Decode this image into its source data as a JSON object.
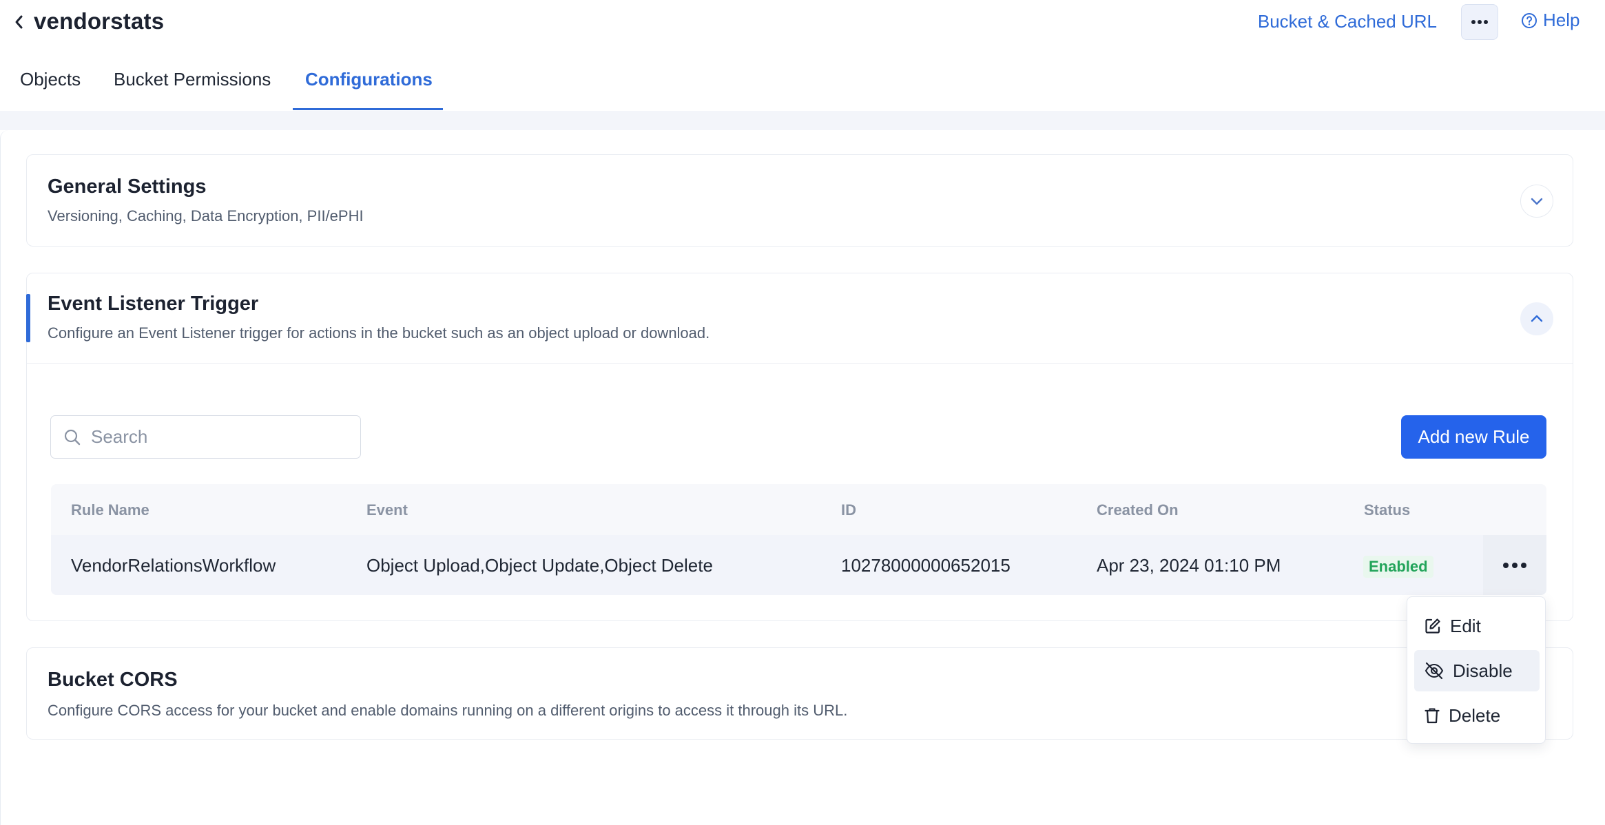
{
  "header": {
    "title": "vendorstats",
    "bucket_url_label": "Bucket & Cached URL",
    "help_label": "Help"
  },
  "tabs": [
    {
      "label": "Objects",
      "active": false
    },
    {
      "label": "Bucket Permissions",
      "active": false
    },
    {
      "label": "Configurations",
      "active": true
    }
  ],
  "panels": {
    "general": {
      "title": "General Settings",
      "description": "Versioning, Caching, Data Encryption, PII/ePHI",
      "expanded": false
    },
    "event_listener": {
      "title": "Event Listener Trigger",
      "description": "Configure an Event Listener trigger for actions in the bucket such as an object upload or download.",
      "expanded": true,
      "search_placeholder": "Search",
      "add_rule_label": "Add new Rule",
      "table": {
        "columns": [
          "Rule Name",
          "Event",
          "ID",
          "Created On",
          "Status"
        ],
        "rows": [
          {
            "rule_name": "VendorRelationsWorkflow",
            "event": "Object Upload,Object Update,Object Delete",
            "id": "10278000000652015",
            "created_on": "Apr 23, 2024 01:10 PM",
            "status": "Enabled"
          }
        ]
      },
      "row_menu": {
        "items": [
          {
            "label": "Edit",
            "icon": "edit-icon"
          },
          {
            "label": "Disable",
            "icon": "eye-off-icon"
          },
          {
            "label": "Delete",
            "icon": "trash-icon"
          }
        ]
      }
    },
    "cors": {
      "title": "Bucket CORS",
      "description": "Configure CORS access for your bucket and enable domains running on a different origins to access it through its URL.",
      "expanded": false
    }
  },
  "colors": {
    "accent": "#2f6bd8",
    "primary_button": "#2563eb",
    "status_enabled": "#22a45a"
  }
}
